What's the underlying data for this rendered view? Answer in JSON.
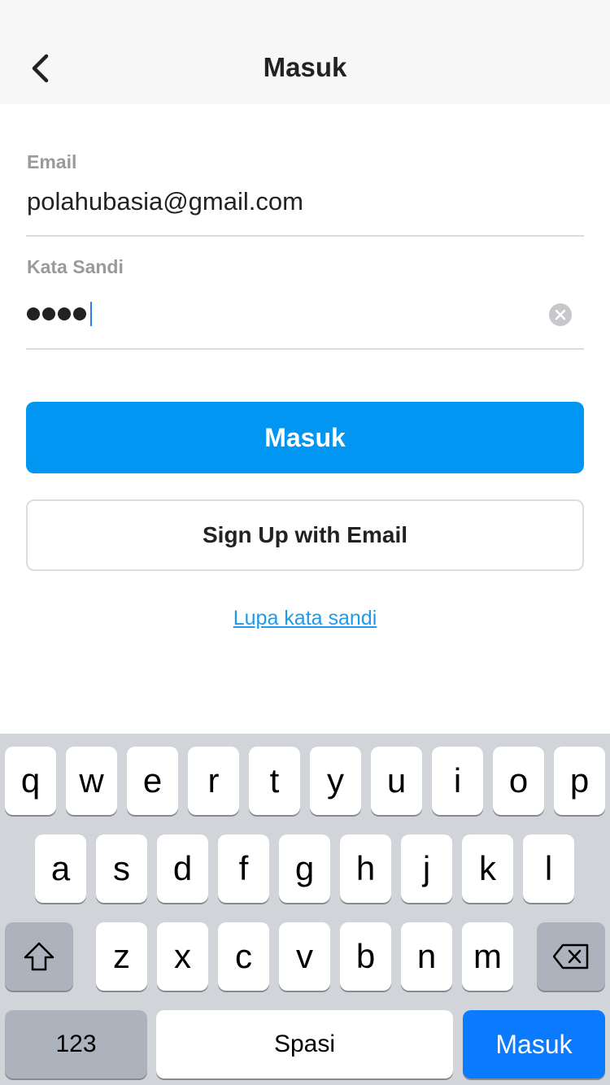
{
  "navbar": {
    "title": "Masuk"
  },
  "form": {
    "email_label": "Email",
    "email_value": "polahubasia@gmail.com",
    "password_label": "Kata Sandi",
    "password_length": 4
  },
  "actions": {
    "login_label": "Masuk",
    "signup_label": "Sign Up with Email",
    "forgot_label": "Lupa kata sandi"
  },
  "keyboard": {
    "row1": [
      "q",
      "w",
      "e",
      "r",
      "t",
      "y",
      "u",
      "i",
      "o",
      "p"
    ],
    "row2": [
      "a",
      "s",
      "d",
      "f",
      "g",
      "h",
      "j",
      "k",
      "l"
    ],
    "row3": [
      "z",
      "x",
      "c",
      "v",
      "b",
      "n",
      "m"
    ],
    "shift_icon": "shift-icon",
    "delete_icon": "backspace-icon",
    "numbers_label": "123",
    "space_label": "Spasi",
    "return_label": "Masuk"
  },
  "colors": {
    "primary": "#0096f2",
    "link": "#1e9be8",
    "keyboard_return": "#0a7aff"
  }
}
